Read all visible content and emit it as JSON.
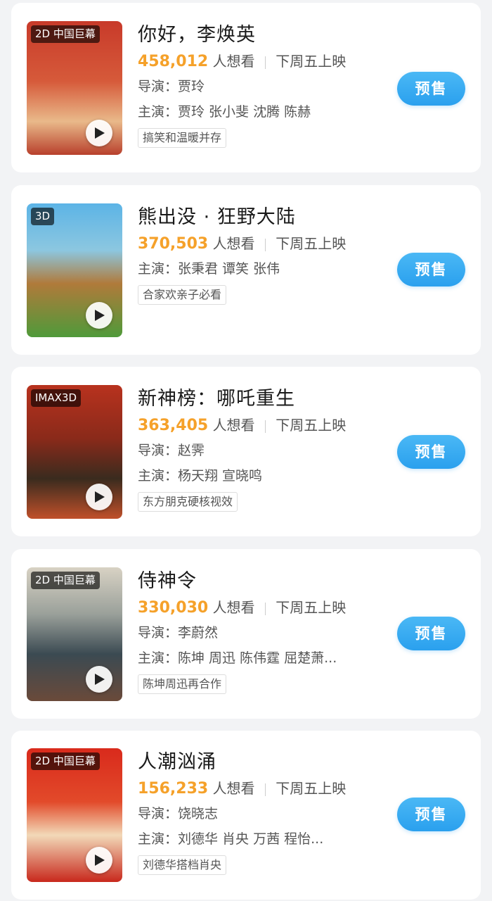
{
  "colors": {
    "page_bg": "#f2f3f5",
    "card_bg": "#ffffff",
    "want_count": "#f5a12a",
    "presale_button": "#2aa0ee"
  },
  "play_icon": "play-icon",
  "movies": [
    {
      "badge": "2D 中国巨幕",
      "title": "你好，李焕英",
      "want_count": "458,012",
      "want_label": "人想看",
      "release": "下周五上映",
      "director": "导演：贾玲",
      "cast": "主演：贾玲 张小斐 沈腾 陈赫",
      "tag": "搞笑和温暖并存",
      "presale_label": "预售",
      "poster_colors": [
        "#c83a2a",
        "#e9b98a"
      ]
    },
    {
      "badge": "3D",
      "title": "熊出没 · 狂野大陆",
      "want_count": "370,503",
      "want_label": "人想看",
      "release": "下周五上映",
      "director": "",
      "cast": "主演：张秉君 谭笑 张伟",
      "tag": "合家欢亲子必看",
      "presale_label": "预售",
      "poster_colors": [
        "#5cb4e6",
        "#4f9a3a"
      ]
    },
    {
      "badge": "IMAX3D",
      "title": "新神榜：哪吒重生",
      "want_count": "363,405",
      "want_label": "人想看",
      "release": "下周五上映",
      "director": "导演：赵霁",
      "cast": "主演：杨天翔 宣晓鸣",
      "tag": "东方朋克硬核视效",
      "presale_label": "预售",
      "poster_colors": [
        "#b8321e",
        "#3a2b1e"
      ]
    },
    {
      "badge": "2D 中国巨幕",
      "title": "侍神令",
      "want_count": "330,030",
      "want_label": "人想看",
      "release": "下周五上映",
      "director": "导演：李蔚然",
      "cast": "主演：陈坤 周迅 陈伟霆 屈楚萧...",
      "tag": "陈坤周迅再合作",
      "presale_label": "预售",
      "poster_colors": [
        "#d8d2c4",
        "#3b4a52"
      ]
    },
    {
      "badge": "2D 中国巨幕",
      "title": "人潮汹涌",
      "want_count": "156,233",
      "want_label": "人想看",
      "release": "下周五上映",
      "director": "导演：饶晓志",
      "cast": "主演：刘德华 肖央 万茜 程怡...",
      "tag": "刘德华搭档肖央",
      "presale_label": "预售",
      "poster_colors": [
        "#d92a1c",
        "#f2d9b8"
      ]
    }
  ]
}
